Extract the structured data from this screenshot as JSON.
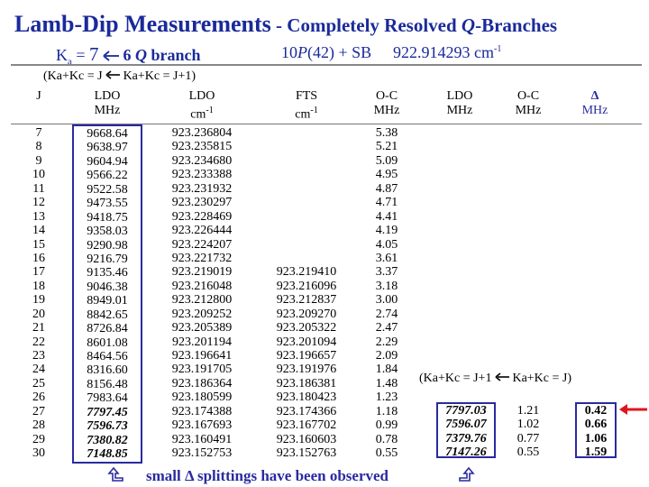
{
  "title": {
    "main": "Lamb-Dip Measurements",
    "sep": " - ",
    "sub_a": "Completely Resolved ",
    "sub_q": "Q",
    "sub_b": "-Branches"
  },
  "subhead": {
    "ka_label": "K",
    "ka_sub": "a",
    "ka_eq": " = ",
    "ka_seven": "7",
    "ka_six": " 6  ",
    "q": "Q",
    "branch": " branch",
    "band_a": "10",
    "band_p": "P",
    "band_b": "(42) + SB",
    "freq": "922.914293 cm",
    "freq_sup": "-1"
  },
  "branch_label": {
    "left": "(Ka+Kc = J",
    "right": " Ka+Kc = J+1)"
  },
  "headers": {
    "j": "J",
    "ldo_mhz_1": "LDO",
    "ldo_mhz_2": "MHz",
    "ldo_cm_1": "LDO",
    "ldo_cm_2": "cm",
    "ldo_cm_sup": "-1",
    "fts_1": "FTS",
    "fts_2": "cm",
    "fts_sup": "-1",
    "oc_1": "O-C",
    "oc_2": "MHz",
    "ldo2_1": "LDO",
    "ldo2_2": "MHz",
    "oc2_1": "O-C",
    "oc2_2": "MHz",
    "delta_1": "Δ",
    "delta_2": "MHz"
  },
  "rows": {
    "j": [
      "7",
      "8",
      "9",
      "10",
      "11",
      "12",
      "13",
      "14",
      "15",
      "16",
      "17",
      "18",
      "19",
      "20",
      "21",
      "22",
      "23",
      "24",
      "25",
      "26",
      "27",
      "28",
      "29",
      "30"
    ],
    "ldo_mhz": [
      "9668.64",
      "9638.97",
      "9604.94",
      "9566.22",
      "9522.58",
      "9473.55",
      "9418.75",
      "9358.03",
      "9290.98",
      "9216.79",
      "9135.46",
      "9046.38",
      "8949.01",
      "8842.65",
      "8726.84",
      "8601.08",
      "8464.56",
      "8316.60",
      "8156.48",
      "7983.64",
      "7797.45",
      "7596.73",
      "7380.82",
      "7148.85"
    ],
    "ldo_cm": [
      "923.236804",
      "923.235815",
      "923.234680",
      "923.233388",
      "923.231932",
      "923.230297",
      "923.228469",
      "923.226444",
      "923.224207",
      "923.221732",
      "923.219019",
      "923.216048",
      "923.212800",
      "923.209252",
      "923.205389",
      "923.201194",
      "923.196641",
      "923.191705",
      "923.186364",
      "923.180599",
      "923.174388",
      "923.167693",
      "923.160491",
      "923.152753"
    ],
    "fts": [
      "",
      "",
      "",
      "",
      "",
      "",
      "",
      "",
      "",
      "",
      "923.219410",
      "923.216096",
      "923.212837",
      "923.209270",
      "923.205322",
      "923.201094",
      "923.196657",
      "923.191976",
      "923.186381",
      "923.180423",
      "923.174366",
      "923.167702",
      "923.160603",
      "923.152763"
    ],
    "oc": [
      "5.38",
      "5.21",
      "5.09",
      "4.95",
      "4.87",
      "4.71",
      "4.41",
      "4.19",
      "4.05",
      "3.61",
      "3.37",
      "3.18",
      "3.00",
      "2.74",
      "2.47",
      "2.29",
      "2.09",
      "1.84",
      "1.48",
      "1.23",
      "1.18",
      "0.99",
      "0.78",
      "0.55"
    ]
  },
  "second_branch": {
    "note_left": "(Ka+Kc = J+1",
    "note_right": " Ka+Kc = J)",
    "ldo": [
      "7797.03",
      "7596.07",
      "7379.76",
      "7147.26"
    ],
    "oc": [
      "1.21",
      "1.02",
      "0.77",
      "0.55"
    ],
    "delta": [
      "0.42",
      "0.66",
      "1.06",
      "1.59"
    ]
  },
  "footer": {
    "a": "small ",
    "delta": "Δ",
    "b": " splittings have been observed"
  },
  "colors": {
    "title": "#1a2a9a",
    "box": "#2a2aa0",
    "arrow": "#e0141e",
    "rule": "#888888"
  },
  "icons": [
    "left-arrow-icon",
    "up-arrow-icon",
    "red-arrow-icon"
  ]
}
